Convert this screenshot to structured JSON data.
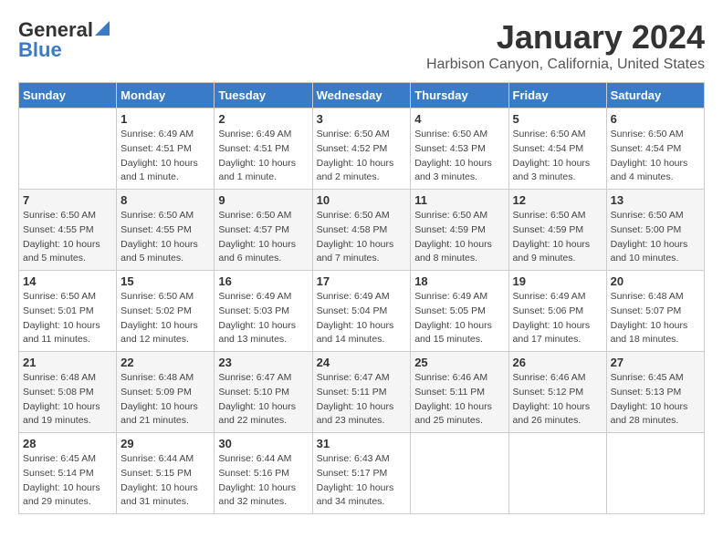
{
  "logo": {
    "general": "General",
    "blue": "Blue"
  },
  "title": "January 2024",
  "location": "Harbison Canyon, California, United States",
  "weekdays": [
    "Sunday",
    "Monday",
    "Tuesday",
    "Wednesday",
    "Thursday",
    "Friday",
    "Saturday"
  ],
  "weeks": [
    [
      {
        "day": "",
        "sunrise": "",
        "sunset": "",
        "daylight": ""
      },
      {
        "day": "1",
        "sunrise": "Sunrise: 6:49 AM",
        "sunset": "Sunset: 4:51 PM",
        "daylight": "Daylight: 10 hours and 1 minute."
      },
      {
        "day": "2",
        "sunrise": "Sunrise: 6:49 AM",
        "sunset": "Sunset: 4:51 PM",
        "daylight": "Daylight: 10 hours and 1 minute."
      },
      {
        "day": "3",
        "sunrise": "Sunrise: 6:50 AM",
        "sunset": "Sunset: 4:52 PM",
        "daylight": "Daylight: 10 hours and 2 minutes."
      },
      {
        "day": "4",
        "sunrise": "Sunrise: 6:50 AM",
        "sunset": "Sunset: 4:53 PM",
        "daylight": "Daylight: 10 hours and 3 minutes."
      },
      {
        "day": "5",
        "sunrise": "Sunrise: 6:50 AM",
        "sunset": "Sunset: 4:54 PM",
        "daylight": "Daylight: 10 hours and 3 minutes."
      },
      {
        "day": "6",
        "sunrise": "Sunrise: 6:50 AM",
        "sunset": "Sunset: 4:54 PM",
        "daylight": "Daylight: 10 hours and 4 minutes."
      }
    ],
    [
      {
        "day": "7",
        "sunrise": "Sunrise: 6:50 AM",
        "sunset": "Sunset: 4:55 PM",
        "daylight": "Daylight: 10 hours and 5 minutes."
      },
      {
        "day": "8",
        "sunrise": "Sunrise: 6:50 AM",
        "sunset": "Sunset: 4:55 PM",
        "daylight": "Daylight: 10 hours and 5 minutes."
      },
      {
        "day": "9",
        "sunrise": "Sunrise: 6:50 AM",
        "sunset": "Sunset: 4:57 PM",
        "daylight": "Daylight: 10 hours and 6 minutes."
      },
      {
        "day": "10",
        "sunrise": "Sunrise: 6:50 AM",
        "sunset": "Sunset: 4:58 PM",
        "daylight": "Daylight: 10 hours and 7 minutes."
      },
      {
        "day": "11",
        "sunrise": "Sunrise: 6:50 AM",
        "sunset": "Sunset: 4:59 PM",
        "daylight": "Daylight: 10 hours and 8 minutes."
      },
      {
        "day": "12",
        "sunrise": "Sunrise: 6:50 AM",
        "sunset": "Sunset: 4:59 PM",
        "daylight": "Daylight: 10 hours and 9 minutes."
      },
      {
        "day": "13",
        "sunrise": "Sunrise: 6:50 AM",
        "sunset": "Sunset: 5:00 PM",
        "daylight": "Daylight: 10 hours and 10 minutes."
      }
    ],
    [
      {
        "day": "14",
        "sunrise": "Sunrise: 6:50 AM",
        "sunset": "Sunset: 5:01 PM",
        "daylight": "Daylight: 10 hours and 11 minutes."
      },
      {
        "day": "15",
        "sunrise": "Sunrise: 6:50 AM",
        "sunset": "Sunset: 5:02 PM",
        "daylight": "Daylight: 10 hours and 12 minutes."
      },
      {
        "day": "16",
        "sunrise": "Sunrise: 6:49 AM",
        "sunset": "Sunset: 5:03 PM",
        "daylight": "Daylight: 10 hours and 13 minutes."
      },
      {
        "day": "17",
        "sunrise": "Sunrise: 6:49 AM",
        "sunset": "Sunset: 5:04 PM",
        "daylight": "Daylight: 10 hours and 14 minutes."
      },
      {
        "day": "18",
        "sunrise": "Sunrise: 6:49 AM",
        "sunset": "Sunset: 5:05 PM",
        "daylight": "Daylight: 10 hours and 15 minutes."
      },
      {
        "day": "19",
        "sunrise": "Sunrise: 6:49 AM",
        "sunset": "Sunset: 5:06 PM",
        "daylight": "Daylight: 10 hours and 17 minutes."
      },
      {
        "day": "20",
        "sunrise": "Sunrise: 6:48 AM",
        "sunset": "Sunset: 5:07 PM",
        "daylight": "Daylight: 10 hours and 18 minutes."
      }
    ],
    [
      {
        "day": "21",
        "sunrise": "Sunrise: 6:48 AM",
        "sunset": "Sunset: 5:08 PM",
        "daylight": "Daylight: 10 hours and 19 minutes."
      },
      {
        "day": "22",
        "sunrise": "Sunrise: 6:48 AM",
        "sunset": "Sunset: 5:09 PM",
        "daylight": "Daylight: 10 hours and 21 minutes."
      },
      {
        "day": "23",
        "sunrise": "Sunrise: 6:47 AM",
        "sunset": "Sunset: 5:10 PM",
        "daylight": "Daylight: 10 hours and 22 minutes."
      },
      {
        "day": "24",
        "sunrise": "Sunrise: 6:47 AM",
        "sunset": "Sunset: 5:11 PM",
        "daylight": "Daylight: 10 hours and 23 minutes."
      },
      {
        "day": "25",
        "sunrise": "Sunrise: 6:46 AM",
        "sunset": "Sunset: 5:11 PM",
        "daylight": "Daylight: 10 hours and 25 minutes."
      },
      {
        "day": "26",
        "sunrise": "Sunrise: 6:46 AM",
        "sunset": "Sunset: 5:12 PM",
        "daylight": "Daylight: 10 hours and 26 minutes."
      },
      {
        "day": "27",
        "sunrise": "Sunrise: 6:45 AM",
        "sunset": "Sunset: 5:13 PM",
        "daylight": "Daylight: 10 hours and 28 minutes."
      }
    ],
    [
      {
        "day": "28",
        "sunrise": "Sunrise: 6:45 AM",
        "sunset": "Sunset: 5:14 PM",
        "daylight": "Daylight: 10 hours and 29 minutes."
      },
      {
        "day": "29",
        "sunrise": "Sunrise: 6:44 AM",
        "sunset": "Sunset: 5:15 PM",
        "daylight": "Daylight: 10 hours and 31 minutes."
      },
      {
        "day": "30",
        "sunrise": "Sunrise: 6:44 AM",
        "sunset": "Sunset: 5:16 PM",
        "daylight": "Daylight: 10 hours and 32 minutes."
      },
      {
        "day": "31",
        "sunrise": "Sunrise: 6:43 AM",
        "sunset": "Sunset: 5:17 PM",
        "daylight": "Daylight: 10 hours and 34 minutes."
      },
      {
        "day": "",
        "sunrise": "",
        "sunset": "",
        "daylight": ""
      },
      {
        "day": "",
        "sunrise": "",
        "sunset": "",
        "daylight": ""
      },
      {
        "day": "",
        "sunrise": "",
        "sunset": "",
        "daylight": ""
      }
    ]
  ]
}
